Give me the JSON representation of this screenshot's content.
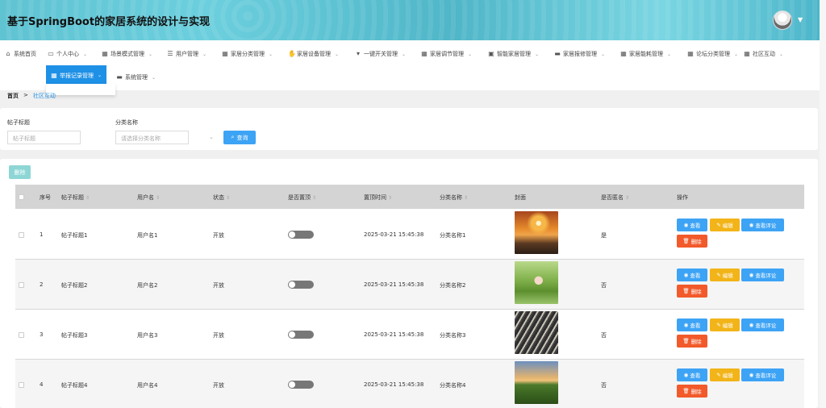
{
  "header": {
    "title": "基于SpringBoot的家居系统的设计与实现"
  },
  "nav": {
    "items": [
      {
        "label": "系统首页",
        "icon": "home-icon"
      },
      {
        "label": "个人中心",
        "icon": "person-icon"
      },
      {
        "label": "场景模式管理",
        "icon": "grid-icon"
      },
      {
        "label": "用户管理",
        "icon": "sliders-icon"
      },
      {
        "label": "家居分类管理",
        "icon": "grid-icon"
      },
      {
        "label": "家居设备管理",
        "icon": "thumb-icon"
      },
      {
        "label": "一键开关管理",
        "icon": "cup-icon"
      },
      {
        "label": "家居调节管理",
        "icon": "grid-icon"
      },
      {
        "label": "智能家居管理",
        "icon": "clipboard-icon"
      },
      {
        "label": "家居报修管理",
        "icon": "chat-icon"
      },
      {
        "label": "家居能耗管理",
        "icon": "grid-icon"
      },
      {
        "label": "论坛分类管理",
        "icon": "grid-icon"
      },
      {
        "label": "社区互动",
        "icon": "grid-icon"
      },
      {
        "label": "举报记录管理",
        "icon": "table-icon"
      },
      {
        "label": "系统管理",
        "icon": "briefcase-icon"
      }
    ]
  },
  "breadcrumb": {
    "home": "首页",
    "separator": ">",
    "current": "社区互动"
  },
  "search": {
    "title_label": "帖子标题",
    "title_placeholder": "帖子标题",
    "category_label": "分类名称",
    "category_placeholder": "请选择分类名称",
    "query_button": "查询"
  },
  "toolbar": {
    "delete_button": "删除"
  },
  "table": {
    "headers": [
      "序号",
      "帖子标题",
      "用户名",
      "状态",
      "是否置顶",
      "置顶时间",
      "分类名称",
      "封面",
      "是否匿名",
      "操作"
    ],
    "rows": [
      {
        "index": "1",
        "title": "帖子标题1",
        "username": "用户名1",
        "status": "开放",
        "pinned": false,
        "pin_time": "2025-03-21 15:45:38",
        "category": "分类名称1",
        "anonymous": "是"
      },
      {
        "index": "2",
        "title": "帖子标题2",
        "username": "用户名2",
        "status": "开放",
        "pinned": false,
        "pin_time": "2025-03-21 15:45:38",
        "category": "分类名称2",
        "anonymous": "否"
      },
      {
        "index": "3",
        "title": "帖子标题3",
        "username": "用户名3",
        "status": "开放",
        "pinned": false,
        "pin_time": "2025-03-21 15:45:38",
        "category": "分类名称3",
        "anonymous": "否"
      },
      {
        "index": "4",
        "title": "帖子标题4",
        "username": "用户名4",
        "status": "开放",
        "pinned": false,
        "pin_time": "2025-03-21 15:45:38",
        "category": "分类名称4",
        "anonymous": "否"
      }
    ],
    "actions": {
      "view": "查看",
      "edit": "编辑",
      "comments": "查看评论",
      "delete": "删除"
    }
  },
  "colors": {
    "primary": "#3da3f5",
    "warning": "#f2b418",
    "danger": "#f25a2b",
    "nav_active": "#1e90e6"
  }
}
